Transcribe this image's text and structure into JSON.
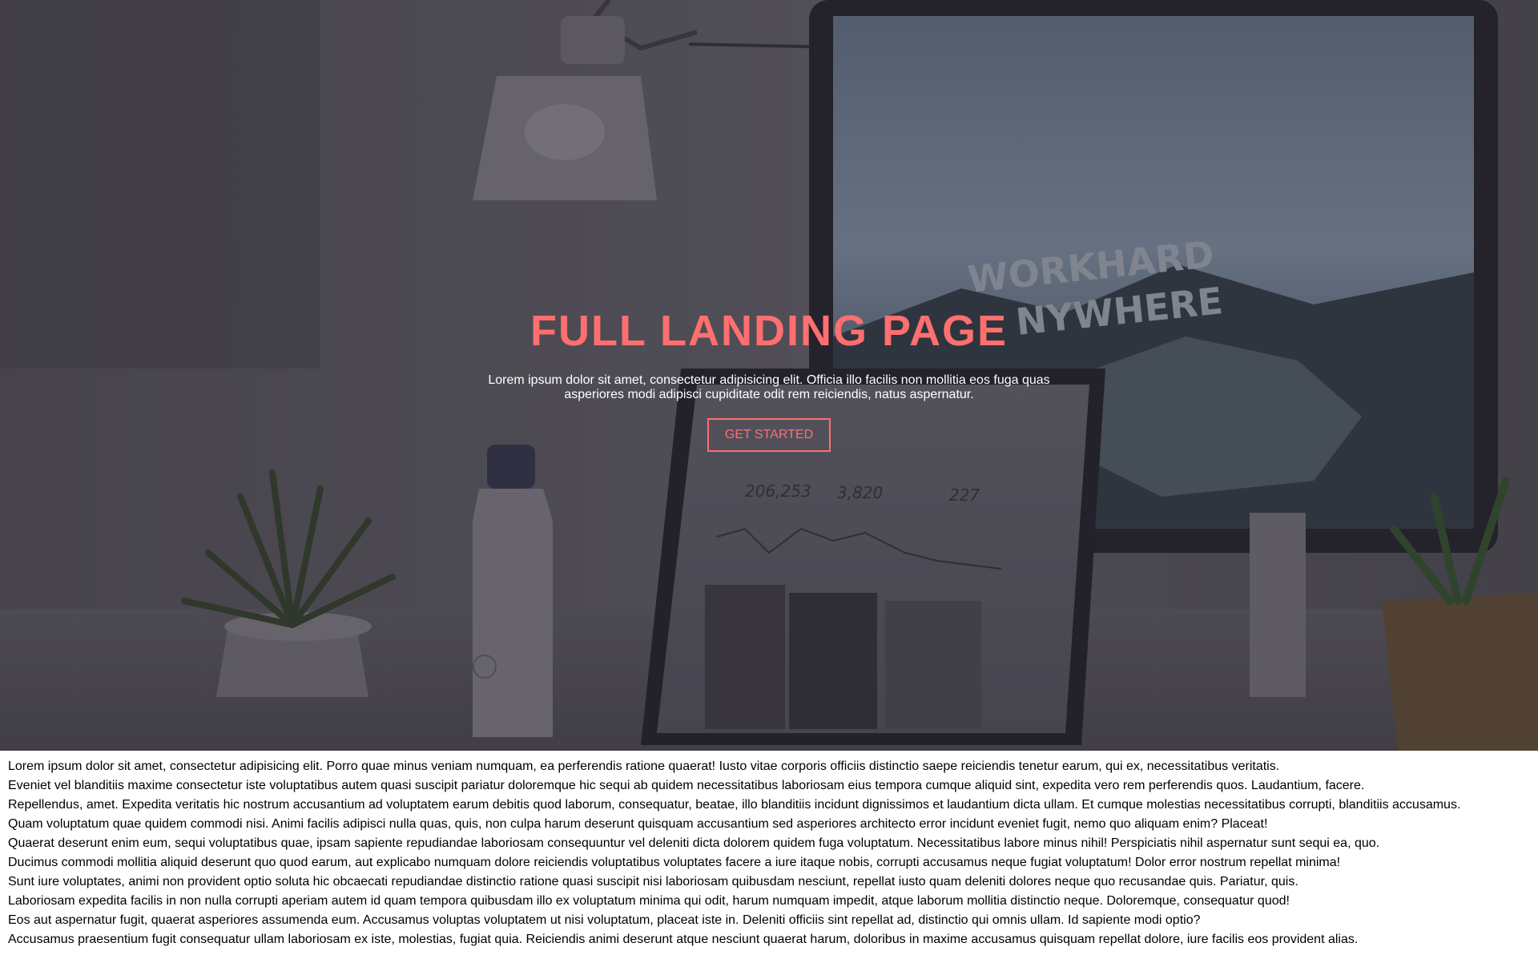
{
  "colors": {
    "accent": "#ff6f6f",
    "hero_text": "#ffffff",
    "body_text": "#000000"
  },
  "hero": {
    "title": "FULL LANDING PAGE",
    "subtitle": "Lorem ipsum dolor sit amet, consectetur adipisicing elit. Officia illo facilis non mollitia eos fuga quas asperiores modi adipisci cupiditate odit rem reiciendis, natus aspernatur.",
    "cta_label": "GET STARTED",
    "background_image": {
      "monitor_text_line1": "WORKHARD",
      "monitor_text_line2": "NYWHERE",
      "laptop_stats": [
        "206,253",
        "3,820",
        "227"
      ]
    }
  },
  "content": {
    "paragraphs": [
      "Lorem ipsum dolor sit amet, consectetur adipisicing elit. Porro quae minus veniam numquam, ea perferendis ratione quaerat! Iusto vitae corporis officiis distinctio saepe reiciendis tenetur earum, qui ex, necessitatibus veritatis.",
      "Eveniet vel blanditiis maxime consectetur iste voluptatibus autem quasi suscipit pariatur doloremque hic sequi ab quidem necessitatibus laboriosam eius tempora cumque aliquid sint, expedita vero rem perferendis quos. Laudantium, facere.",
      "Repellendus, amet. Expedita veritatis hic nostrum accusantium ad voluptatem earum debitis quod laborum, consequatur, beatae, illo blanditiis incidunt dignissimos et laudantium dicta ullam. Et cumque molestias necessitatibus corrupti, blanditiis accusamus.",
      "Quam voluptatum quae quidem commodi nisi. Animi facilis adipisci nulla quas, quis, non culpa harum deserunt quisquam accusantium sed asperiores architecto error incidunt eveniet fugit, nemo quo aliquam enim? Placeat!",
      "Quaerat deserunt enim eum, sequi voluptatibus quae, ipsam sapiente repudiandae laboriosam consequuntur vel deleniti dicta dolorem quidem fuga voluptatum. Necessitatibus labore minus nihil! Perspiciatis nihil aspernatur sunt sequi ea, quo.",
      "Ducimus commodi mollitia aliquid deserunt quo quod earum, aut explicabo numquam dolore reiciendis voluptatibus voluptates facere a iure itaque nobis, corrupti accusamus neque fugiat voluptatum! Dolor error nostrum repellat minima!",
      "Sunt iure voluptates, animi non provident optio soluta hic obcaecati repudiandae distinctio ratione quasi suscipit nisi laboriosam quibusdam nesciunt, repellat iusto quam deleniti dolores neque quo recusandae quis. Pariatur, quis.",
      "Laboriosam expedita facilis in non nulla corrupti aperiam autem id quam tempora quibusdam illo ex voluptatum minima qui odit, harum numquam impedit, atque laborum mollitia distinctio neque. Doloremque, consequatur quod!",
      "Eos aut aspernatur fugit, quaerat asperiores assumenda eum. Accusamus voluptas voluptatem ut nisi voluptatum, placeat iste in. Deleniti officiis sint repellat ad, distinctio qui omnis ullam. Id sapiente modi optio?",
      "Accusamus praesentium fugit consequatur ullam laboriosam ex iste, molestias, fugiat quia. Reiciendis animi deserunt atque nesciunt quaerat harum, doloribus in maxime accusamus quisquam repellat dolore, iure facilis eos provident alias."
    ]
  }
}
